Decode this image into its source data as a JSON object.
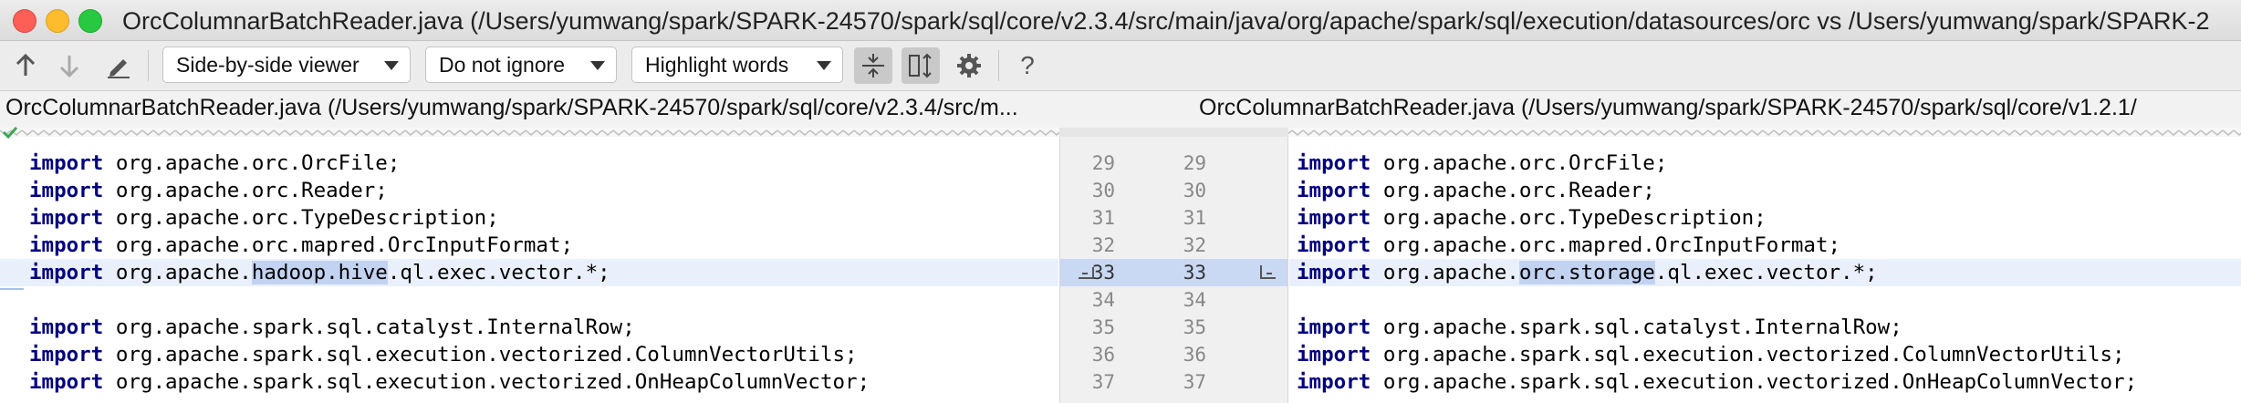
{
  "window": {
    "title": "OrcColumnarBatchReader.java (/Users/yumwang/spark/SPARK-24570/spark/sql/core/v2.3.4/src/main/java/org/apache/spark/sql/execution/datasources/orc vs /Users/yumwang/spark/SPARK-2"
  },
  "toolbar": {
    "viewer_mode": "Side-by-side viewer",
    "whitespace_mode": "Do not ignore",
    "highlight_mode": "Highlight words",
    "help_label": "?"
  },
  "files": {
    "left_path": "OrcColumnarBatchReader.java (/Users/yumwang/spark/SPARK-24570/spark/sql/core/v2.3.4/src/m...",
    "right_path": "OrcColumnarBatchReader.java (/Users/yumwang/spark/SPARK-24570/spark/sql/core/v1.2.1/"
  },
  "left_lines": [
    {
      "kw": "import",
      "text": " org.apache.orc.OrcFile;"
    },
    {
      "kw": "import",
      "text": " org.apache.orc.Reader;"
    },
    {
      "kw": "import",
      "text": " org.apache.orc.TypeDescription;"
    },
    {
      "kw": "import",
      "text": " org.apache.orc.mapred.OrcInputFormat;"
    },
    {
      "kw": "import",
      "pre": " org.apache.",
      "hl": "hadoop.hive",
      "post": ".ql.exec.vector.*;",
      "changed": true
    },
    {
      "kw": "",
      "text": ""
    },
    {
      "kw": "import",
      "text": " org.apache.spark.sql.catalyst.InternalRow;"
    },
    {
      "kw": "import",
      "text": " org.apache.spark.sql.execution.vectorized.ColumnVectorUtils;"
    },
    {
      "kw": "import",
      "text": " org.apache.spark.sql.execution.vectorized.OnHeapColumnVector;"
    }
  ],
  "right_lines": [
    {
      "kw": "import",
      "text": " org.apache.orc.OrcFile;"
    },
    {
      "kw": "import",
      "text": " org.apache.orc.Reader;"
    },
    {
      "kw": "import",
      "text": " org.apache.orc.TypeDescription;"
    },
    {
      "kw": "import",
      "text": " org.apache.orc.mapred.OrcInputFormat;"
    },
    {
      "kw": "import",
      "pre": " org.apache.",
      "hl": "orc.storage",
      "post": ".ql.exec.vector.*;",
      "changed": true
    },
    {
      "kw": "",
      "text": ""
    },
    {
      "kw": "import",
      "text": " org.apache.spark.sql.catalyst.InternalRow;"
    },
    {
      "kw": "import",
      "text": " org.apache.spark.sql.execution.vectorized.ColumnVectorUtils;"
    },
    {
      "kw": "import",
      "text": " org.apache.spark.sql.execution.vectorized.OnHeapColumnVector;"
    }
  ],
  "left_numbers": [
    "29",
    "30",
    "31",
    "32",
    "33",
    "34",
    "35",
    "36",
    "37"
  ],
  "right_numbers": [
    "29",
    "30",
    "31",
    "32",
    "33",
    "34",
    "35",
    "36",
    "37"
  ],
  "colors": {
    "keyword": "#000080",
    "changed_line": "#eaf0fb",
    "word_highlight": "#c2d3f2"
  }
}
